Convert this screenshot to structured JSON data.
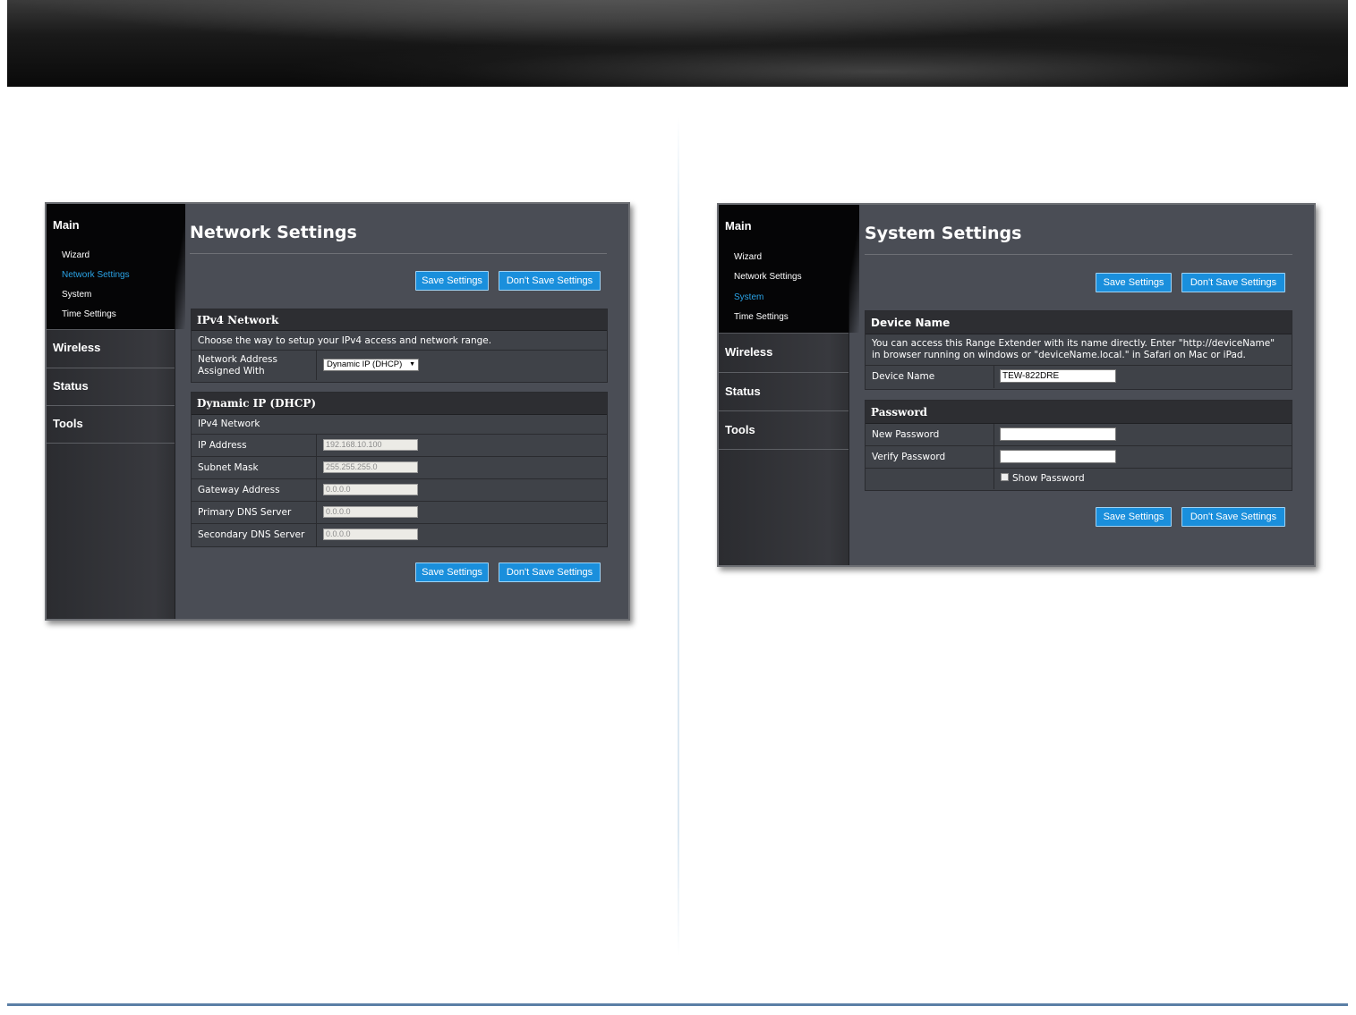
{
  "left": {
    "sidebar": {
      "main": "Main",
      "items": [
        {
          "label": "Wizard"
        },
        {
          "label": "Network Settings"
        },
        {
          "label": "System"
        },
        {
          "label": "Time Settings"
        }
      ],
      "sections": [
        "Wireless",
        "Status",
        "Tools"
      ]
    },
    "title": "Network Settings",
    "buttons": {
      "save": "Save Settings",
      "dont_save": "Don't Save Settings"
    },
    "ipv4": {
      "header": "IPv4 Network",
      "description": "Choose the way to setup your IPv4 access and network range.",
      "assign_label_1": "Network Address",
      "assign_label_2": "Assigned With",
      "assign_value": "Dynamic IP (DHCP)"
    },
    "dhcp": {
      "header": "Dynamic IP (DHCP)",
      "subheader": "IPv4 Network",
      "rows": [
        {
          "label": "IP Address",
          "value": "192.168.10.100"
        },
        {
          "label": "Subnet Mask",
          "value": "255.255.255.0"
        },
        {
          "label": "Gateway Address",
          "value": "0.0.0.0"
        },
        {
          "label": "Primary DNS Server",
          "value": "0.0.0.0"
        },
        {
          "label": "Secondary DNS Server",
          "value": "0.0.0.0"
        }
      ]
    }
  },
  "right": {
    "sidebar": {
      "main": "Main",
      "items": [
        {
          "label": "Wizard"
        },
        {
          "label": "Network Settings"
        },
        {
          "label": "System"
        },
        {
          "label": "Time Settings"
        }
      ],
      "sections": [
        "Wireless",
        "Status",
        "Tools"
      ]
    },
    "title": "System Settings",
    "buttons": {
      "save": "Save Settings",
      "dont_save": "Don't Save Settings"
    },
    "device": {
      "header": "Device Name",
      "description_1": "You can access this Range Extender with its name directly. Enter \"http://deviceName\"",
      "description_2": "in browser running on windows or \"deviceName.local.\" in Safari on Mac or iPad.",
      "label": "Device Name",
      "value": "TEW-822DRE"
    },
    "password": {
      "header": "Password",
      "new_label": "New Password",
      "verify_label": "Verify Password",
      "show_label": "Show Password"
    }
  }
}
